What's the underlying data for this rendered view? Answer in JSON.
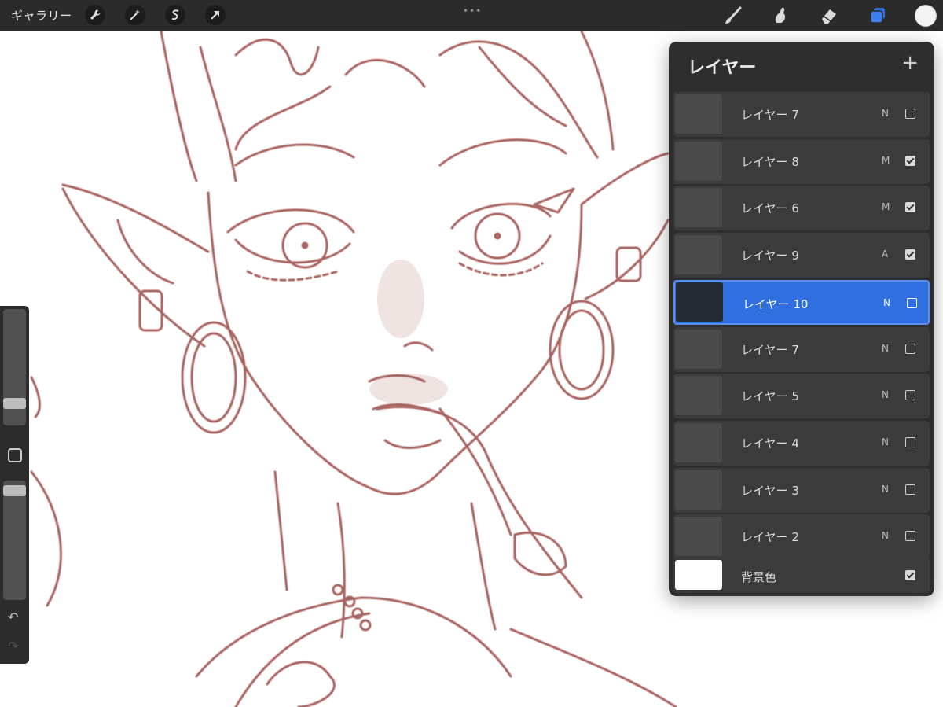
{
  "topbar": {
    "gallery_label": "ギャラリー",
    "left_tools": [
      "wrench-icon",
      "magic-wand-icon",
      "selection-icon",
      "transform-arrow-icon"
    ],
    "right_tools": [
      "brush-icon",
      "smudge-icon",
      "eraser-icon",
      "layers-icon"
    ],
    "current_color": "#f4f4f4",
    "accent_color": "#2f6fe0"
  },
  "layers_panel": {
    "title": "レイヤー",
    "add_symbol": "+",
    "layers": [
      {
        "name": "レイヤー 7",
        "mode": "N",
        "visible": false,
        "selected": false
      },
      {
        "name": "レイヤー 8",
        "mode": "M",
        "visible": true,
        "selected": false
      },
      {
        "name": "レイヤー 6",
        "mode": "M",
        "visible": true,
        "selected": false
      },
      {
        "name": "レイヤー 9",
        "mode": "A",
        "visible": true,
        "selected": false
      },
      {
        "name": "レイヤー 10",
        "mode": "N",
        "visible": false,
        "selected": true
      },
      {
        "name": "レイヤー 7",
        "mode": "N",
        "visible": false,
        "selected": false
      },
      {
        "name": "レイヤー 5",
        "mode": "N",
        "visible": false,
        "selected": false
      },
      {
        "name": "レイヤー 4",
        "mode": "N",
        "visible": false,
        "selected": false
      },
      {
        "name": "レイヤー 3",
        "mode": "N",
        "visible": false,
        "selected": false
      },
      {
        "name": "レイヤー 2",
        "mode": "N",
        "visible": false,
        "selected": false
      }
    ],
    "background": {
      "name": "背景色",
      "visible": true
    }
  },
  "sidebar": {
    "brush_size": 0.16,
    "brush_opacity": 0.96,
    "undo_icon": "undo-icon",
    "redo_icon": "redo-icon"
  },
  "canvas": {
    "line_color": "#9a4a45"
  }
}
